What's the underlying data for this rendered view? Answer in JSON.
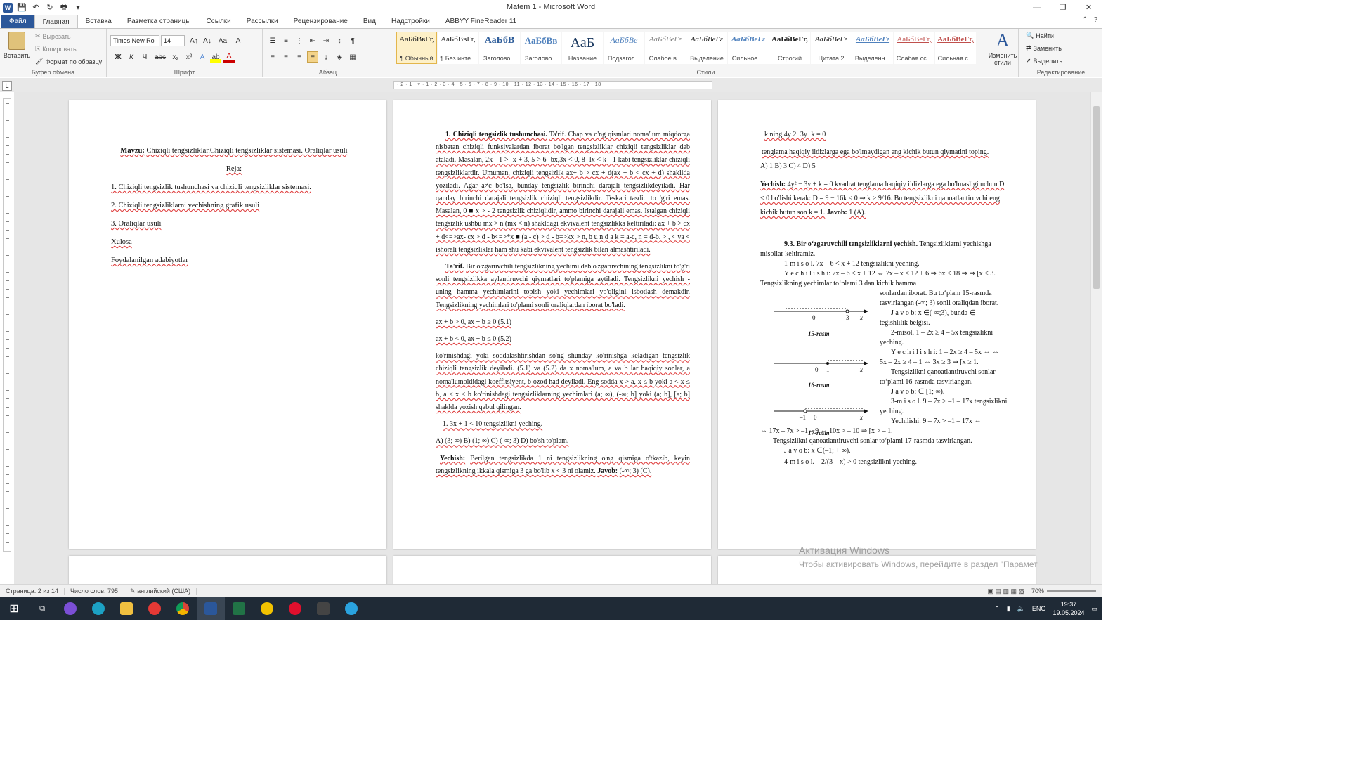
{
  "window": {
    "title": "Matem 1 - Microsoft Word",
    "minimize": "—",
    "restore": "❐",
    "close": "✕"
  },
  "quick_access": [
    "W",
    "💾",
    "↶",
    "↻",
    "🖶",
    "▾"
  ],
  "tabs": [
    "Файл",
    "Главная",
    "Вставка",
    "Разметка страницы",
    "Ссылки",
    "Рассылки",
    "Рецензирование",
    "Вид",
    "Надстройки",
    "ABBYY FineReader 11"
  ],
  "ribbon": {
    "clipboard": {
      "label": "Буфер обмена",
      "paste": "Вставить",
      "cut": "Вырезать",
      "copy": "Копировать",
      "format_painter": "Формат по образцу"
    },
    "font": {
      "label": "Шрифт",
      "name": "Times New Ro",
      "size": "14",
      "bold": "Ж",
      "italic": "К",
      "underline": "Ч",
      "strike": "abc",
      "sub": "x₂",
      "sup": "x²",
      "grow": "A↑",
      "shrink": "A↓",
      "case": "Aa",
      "clear": "A"
    },
    "paragraph": {
      "label": "Абзац"
    },
    "styles": {
      "label": "Стили",
      "items": [
        {
          "preview": "АаБбВвГг,",
          "name": "¶ Обычный"
        },
        {
          "preview": "АаБбВвГг,",
          "name": "¶ Без инте..."
        },
        {
          "preview": "АаБбВ",
          "name": "Заголово..."
        },
        {
          "preview": "АаБбВв",
          "name": "Заголово..."
        },
        {
          "preview": "АаБ",
          "name": "Название"
        },
        {
          "preview": "АаБбВе",
          "name": "Подзагол..."
        },
        {
          "preview": "АаБбВеГг",
          "name": "Слабое в..."
        },
        {
          "preview": "АаБбВеГг",
          "name": "Выделение"
        },
        {
          "preview": "АаБбВеГг",
          "name": "Сильное ..."
        },
        {
          "preview": "АаБбВеГг,",
          "name": "Строгий"
        },
        {
          "preview": "АаБбВеГг",
          "name": "Цитата 2"
        },
        {
          "preview": "АаБбВеГг",
          "name": "Выделенн..."
        },
        {
          "preview": "АаБбВеГг,",
          "name": "Слабая сс..."
        },
        {
          "preview": "АаБбВеГг,",
          "name": "Сильная с..."
        }
      ],
      "change": "Изменить стили"
    },
    "editing": {
      "label": "Редактирование",
      "find": "Найти",
      "replace": "Заменить",
      "select": "Выделить"
    }
  },
  "ruler": "· 2 · 1 · ▾ · 1 · 2 · 3 · 4 · 5 · 6 · 7 · 8 · 9 · 10 · 11 · 12 · 13 · 14 · 15 · 16 · 17 · 18",
  "page1": {
    "topic_label": "Mavzu:",
    "topic": "Chiziqli tengsizliklar.Chiziqli tengsizliklar sistemasi. Oraliqlar usuli",
    "reja": "Reja:",
    "items": [
      "1. Chiziqli tengsizlik tushunchasi va chiziqli tengsizliklar sistemasi.",
      "2. Chiziqli  tengsizliklarni yechishning grafik  usuli",
      "3. Oraliqlar usuli",
      "Xulosa",
      "Foydalanilgan adabiyotlar"
    ]
  },
  "page2": {
    "h1": "1. Chiziqli tengsizlik tushunchasi.",
    "para1": "Ta'rif. Chap va o'ng qismlari noma'lum miqdorga nisbatan chiziqli funksiyalardan iborat bo'lgan tengsizliklar chiziqli tengsizliklar deb ataladi. Masalan, 2x - 1 > -x + 3, 5 > 6- bx,3x < 0, 8- lx < k - 1 kabi tengsizliklar chiziqli tengsizliklardir. Umuman, chiziqli tengsizlik ax+ b > cx + d(ax + b < cx + d) shaklida yoziladi. Agar a≠c bo'lsa, bunday tengsizlik birinchi darajali tengsizlikdeyiladi. Har qanday birinchi darajali tengsizlik chiziqli tengsizlikdir. Teskari tasdiq to 'g'ri emas. Masalan, 0 ■ x > - 2 tengsizlik chiziqlidir, ammo birinchi darajali emas. Istalgan chiziqli tengsizlik ushbu mx > n (mx < n) shakldagi ekvivalent tengsizlikka keltiriladi: ax + b > cx + d<=>ax- cx > d - b<=>*x ■ (a - c) > d - b=>kx > n, b u n d a k = a-c, n = d-b. > , < va < ishorali tengsizliklar ham shu kabi ekvivalent tengsizlik bilan almashtiriladi.",
    "tarif_label": "Ta'rif.",
    "para2": "Bir o'zgaruvchili tengsizlikning yechimi deb o'zgaruvchining tengsizlikni to'g'ri sonli tengsizlikka aylantiruvchi qiymatlari to'plamiga aytiladi. Tengsizlikni yechish - uning hamma yechimlarini topish yoki yechimlari yo'qligini isbotlash demakdir. Tengsizlikning yechimlari to'plami sonli oraliqlardan iborat bo'ladi.",
    "f1": "ax + b > 0, ax + b ≥ 0  (5.1)",
    "f2": "ax + b < 0, ax + b ≤ 0  (5.2)",
    "para3": "ko'rinishdagi yoki soddalashtirishdan so'ng shunday ko'rinishga keladigan tengsizlik chiziqli tengsizlik deyiladi. (5.1) va (5.2) da x noma'lum, a va b lar haqiqiy sonlar, a noma'lumoldidagi koeffitsiyent, b ozod had deyiladi. Eng sodda x > a, x ≤ b yoki a < x ≤ b, a ≤ x ≤ b ko'rinishdagi tengsizliklarning yechimlari (a; ∞), (-∞; b] yoki (a; b], [a; b] shaklda yozish qabul qilingan.",
    "task": "1. 3x + 1 < 10 tengsizlikni yeching.",
    "options": "A) (3; ∞)     B) (1; ∞)     C) (-∞; 3)     D) bo'sh to'plam.",
    "sol_label": "Yechish:",
    "sol": "Berilgan tengsizlikda 1 ni tengsizlikning o'ng qismiga o'tkazib, keyin tengsizlikning ikkala qismiga 3 ga bo'lib x < 3 ni olamiz.",
    "answer_label": "Javob:",
    "answer": "(-∞; 3) (C)."
  },
  "page3": {
    "l1": "k ning 4y 2−3y+k = 0",
    "l2": "tenglama haqiqiy ildizlarga ega bo'lmaydigan eng kichik butun qiymatini toping.",
    "l3": "A) 1    B) 3    C) 4    D) 5",
    "sol_label": "Yechish:",
    "sol": "4y² − 3y + k = 0 kvadrat tenglama haqiqiy ildizlarga ega bo'lmasligi uchun D < 0 bo'lishi kerak: D = 9 − 16k < 0 ⇒ k > 9/16. Bu tengsizlikni qanoatlantiruvchi eng kichik butun son k = 1.",
    "answer_label": "Javob:",
    "answer": "1 (A).",
    "h93": "9.3. Bir o‘zgaruvchili tengsizliklarni yechish.",
    "h93b": "Tengsizliklarni yechishga misollar keltiramiz.",
    "ex1": "1-m i s o l. 7x – 6 < x + 12 tengsizlikni yeching.",
    "ex1sol": "Y e c h i l i s h i: 7x – 6 < x + 12 ⇔ 7x – x < 12 + 6 ⇒  6x < 18 ⇒ ⇒ [x < 3. Tengsizlikning yechimlar to‘plami 3 dan kichik hamma",
    "ex1c": "sonlardan iborat. Bu to‘plam 15-rasmda tasvirlangan (-∞; 3) sonli oraliqdan iborat.",
    "ex1ans": "J a v o b: x ∈(-∞;3), bunda ∈ – tegishlilik belgisi.",
    "ex2": "2-misol. 1 – 2x ≥ 4 – 5x tengsizlikni yeching.",
    "ex2sol": "Y e c h i l i s h i: 1 – 2x ≥ 4 – 5x ⇔ ⇔ 5x – 2x ≥ 4 – 1 ⇔ 3x ≥ 3 ⇒ [x ≥ 1.",
    "ex2c": "Tengsizlikni qanoatlantiruvchi sonlar to‘plami 16-rasmda tasvirlangan.",
    "ex2ans": "J a v o b: ∈ [1; ∞).",
    "ex3": "3-m i s o l.  9 – 7x > –1 – 17x tengsizlikni yeching.",
    "ex3sol": "Yechilishi: 9 – 7x > –1 – 17x ⇔",
    "ex3sol2": "⇔ 17x – 7x > –1 – 9 ⇔ 10x > – 10 ⇒ [x > – 1.",
    "ex3c": "Tengsizlikni qanoatlantiruvchi sonlar to‘plami 17-rasmda tasvirlangan.",
    "ex3ans": "J a v o b: x ∈(–1; + ∞).",
    "ex4": "4-m i s o l. – 2/(3 – x) > 0 tengsizlikni yeching.",
    "fig15": "15-rasm",
    "fig16": "16-rasm",
    "fig17": "17-rasm",
    "fig15_ticks": [
      "0",
      "3",
      "x"
    ],
    "fig16_ticks": [
      "0",
      "1",
      "x"
    ],
    "fig17_ticks": [
      "–1",
      "0",
      "x"
    ]
  },
  "watermark": {
    "line1": "Активация Windows",
    "line2": "Чтобы активировать Windows, перейдите в раздел \"Парамет"
  },
  "status": {
    "page": "Страница: 2 из 14",
    "words": "Число слов: 795",
    "lang": "английский (США)",
    "zoom": "70%"
  },
  "taskbar": {
    "lang": "ENG",
    "time": "19:37",
    "date": "19.05.2024"
  },
  "colors": {
    "word_blue": "#2b579a",
    "taskbar": "#1f2a36"
  }
}
